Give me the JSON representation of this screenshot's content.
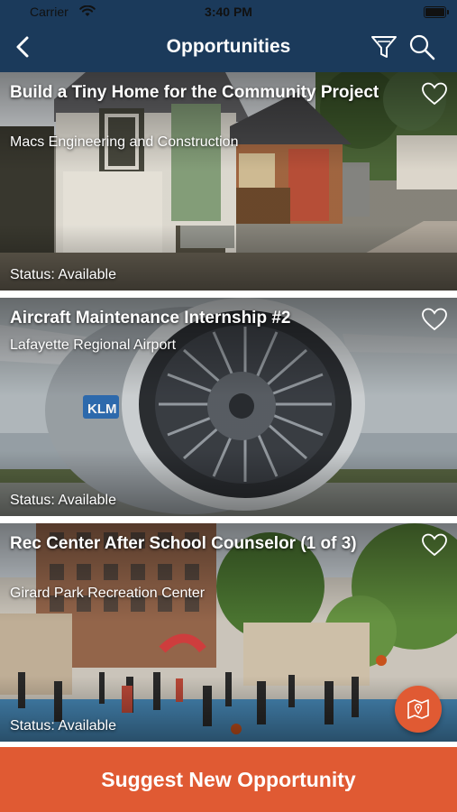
{
  "status_bar": {
    "carrier": "Carrier",
    "time": "3:40 PM"
  },
  "nav": {
    "title": "Opportunities",
    "back_icon": "chevron-left-icon",
    "filter_icon": "filter-icon",
    "search_icon": "search-icon"
  },
  "opportunities": [
    {
      "title": "Build a Tiny Home for the Community Project",
      "organization": "Macs Engineering and Construction",
      "status": "Status: Available",
      "favorited": false
    },
    {
      "title": "Aircraft Maintenance Internship #2",
      "organization": "Lafayette Regional Airport",
      "status": "Status: Available",
      "favorited": false
    },
    {
      "title": "Rec Center After School Counselor (1 of 3)",
      "organization": "Girard Park Recreation Center",
      "status": "Status: Available",
      "favorited": false
    }
  ],
  "map_button": {
    "icon": "map-pin-icon"
  },
  "suggest_button": {
    "label": "Suggest New Opportunity"
  },
  "colors": {
    "navbar": "#1b3a5b",
    "accent": "#e05a33",
    "text_on_image": "#ffffff"
  }
}
